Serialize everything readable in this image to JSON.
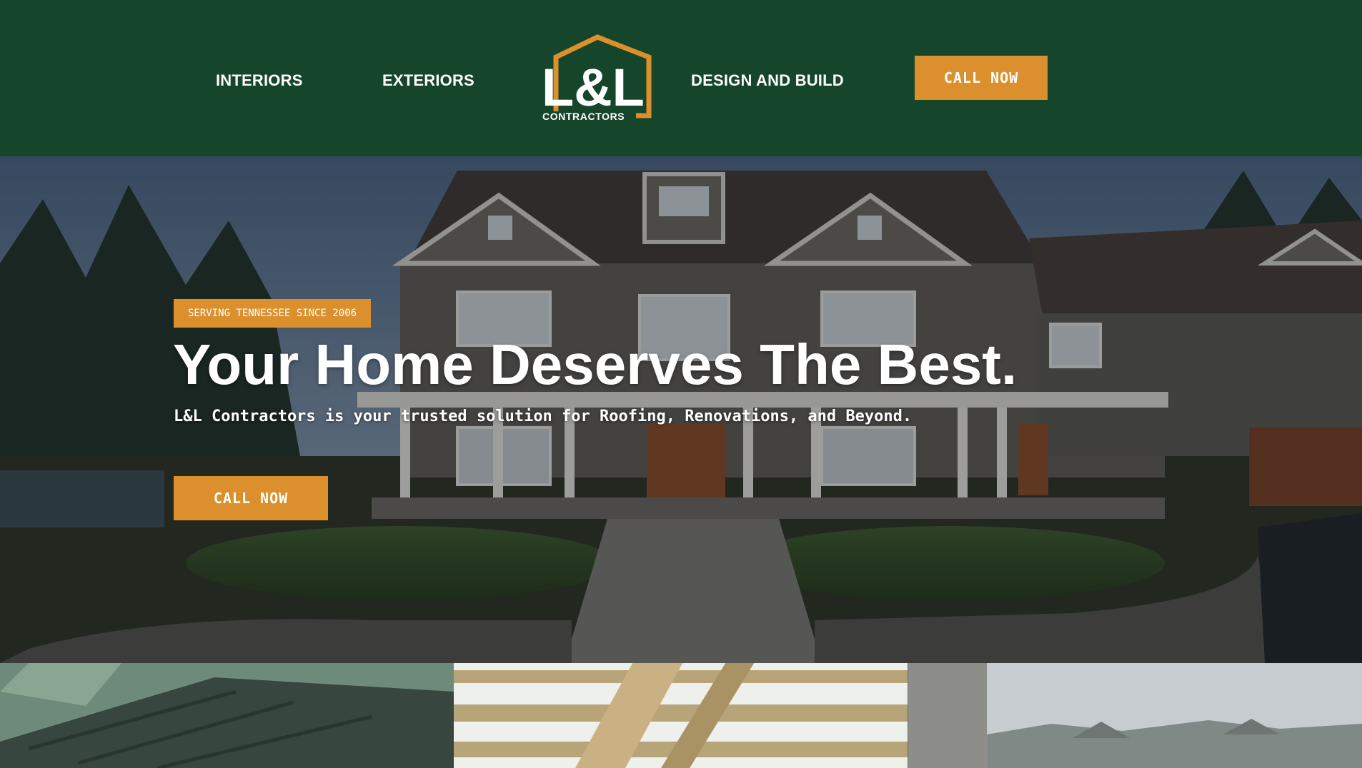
{
  "header": {
    "nav": {
      "interiors": "INTERIORS",
      "exteriors": "EXTERIORS",
      "design_build": "DESIGN AND BUILD"
    },
    "logo": {
      "mark": "L&L",
      "wordmark": "CONTRACTORS"
    },
    "call_label": "CALL NOW"
  },
  "hero": {
    "badge": "SERVING TENNESSEE SINCE 2006",
    "title": "Your Home Deserves The Best.",
    "subtitle": "L&L Contractors is your trusted solution for Roofing, Renovations, and Beyond.",
    "call_label": "CALL NOW",
    "background_image": "house-exterior-photo"
  },
  "tiles": [
    {
      "image": "roof-shingles-photo"
    },
    {
      "image": "wood-ceiling-beams-photo"
    },
    {
      "image": "neighborhood-houses-photo"
    }
  ],
  "colors": {
    "header_bg": "#15452a",
    "accent": "#dc8f2d",
    "text": "#ffffff"
  }
}
